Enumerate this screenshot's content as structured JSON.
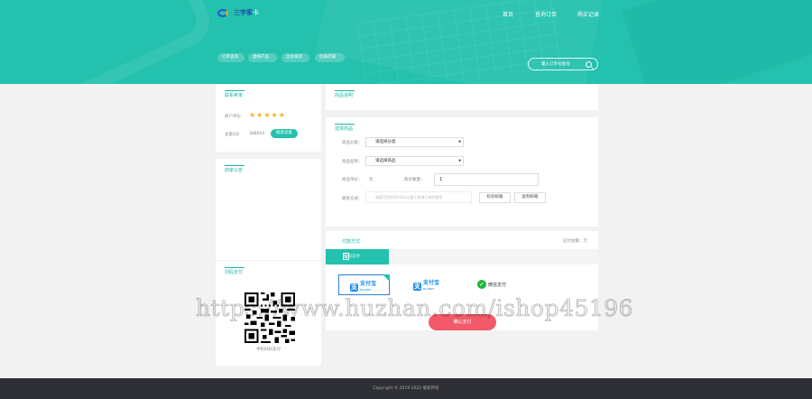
{
  "header": {
    "logo_text": "三字客",
    "logo_sub": "卡",
    "nav": {
      "home": "首页",
      "order": "查询订单",
      "buy": "购买记录"
    },
    "pills": [
      "订单查询",
      "虚拟产品",
      "自动发货",
      "优质店铺"
    ],
    "search_placeholder": "输入订单号查询"
  },
  "seller": {
    "title": "联系卖家",
    "rating_label": "商户评价",
    "stars": 5,
    "stock_label": "卖家QQ",
    "stock_value": "388954",
    "contact_label": "联系卖家"
  },
  "announcement": {
    "title": "商家公告"
  },
  "scan_pay": {
    "title": "扫码支付",
    "caption": "手机扫码支付"
  },
  "goods_desc": {
    "title": "商品说明"
  },
  "purchase": {
    "title": "选择商品",
    "category_label": "商品分类：",
    "category_value": "请选择分类",
    "product_label": "商品名称：",
    "product_value": "请选择商品",
    "price_label": "商品单价：",
    "price_value": "元",
    "qty_label": "购买数量：",
    "qty_value": "1",
    "query_label": "联系方式：",
    "query_placeholder": "请填写您的QQ号码以便于查询订单时使用",
    "btn_verify": "校验邮箱",
    "btn_copy": "复制邮箱"
  },
  "payment": {
    "title": "付款方式",
    "total_label": "应付总额：元",
    "tab_scan": "扫码支付",
    "alipay_text": "支付宝",
    "alipay_sub": "ALIPAY",
    "wechat_text": "微信支付",
    "confirm_label": "确认支付"
  },
  "watermark": "https://www.huzhan.com/ishop45196",
  "footer": "Copyright © 2019-2022 版权所有"
}
